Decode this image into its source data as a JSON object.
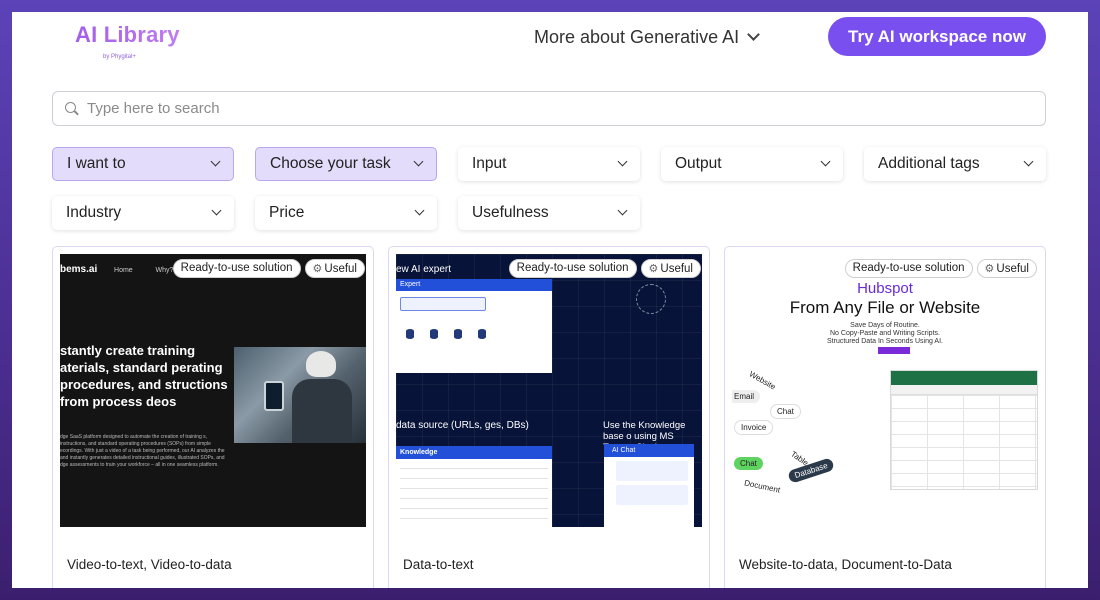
{
  "header": {
    "logo_title": "AI Library",
    "logo_sub": "by Phygital+",
    "nav_more": "More about Generative AI",
    "cta": "Try AI workspace now"
  },
  "search": {
    "placeholder": "Type here to search"
  },
  "filters": [
    {
      "label": "I want to",
      "active": true
    },
    {
      "label": "Choose your task",
      "active": true
    },
    {
      "label": "Input",
      "active": false
    },
    {
      "label": "Output",
      "active": false
    },
    {
      "label": "Additional tags",
      "active": false
    },
    {
      "label": "Industry",
      "active": false
    },
    {
      "label": "Price",
      "active": false
    },
    {
      "label": "Usefulness",
      "active": false
    }
  ],
  "badges": {
    "ready": "Ready-to-use solution",
    "useful": "Useful"
  },
  "cards": [
    {
      "tags": "Video-to-text, Video-to-data",
      "img_brand": "bems.ai",
      "img_home": "Home",
      "img_why": "Why?",
      "img_headline": "stantly create training aterials, standard perating procedures, and structions from process deos",
      "img_body": "dge SaaS platform designed to automate the creation of training s, instructions, and standard operating procedures (SOPs) from simple ecordings. With just a video of a task being performed, our AI analyzes the and instantly generates detailed instructional guides, illustrated SOPs, and dge assessments to train your workforce – all in one seamless platform."
    },
    {
      "tags": "Data-to-text",
      "img_title": "ew AI expert",
      "img_panel_title": "Expert",
      "img_mid": "data source (URLs, ges, DBs)",
      "img_knowledge": "Knowledge",
      "img_right": "Use the Knowledge base o using MS Teams, Slack, or",
      "img_chat": "AI Chat"
    },
    {
      "tags": "Website-to-data, Document-to-Data",
      "img_brand": "Hubspot",
      "img_headline": "From Any File or Website",
      "img_sub1": "Save Days of Routine.",
      "img_sub2": "No Copy-Paste and Writing Scripts.",
      "img_sub3": "Structured Data In Seconds Using AI.",
      "img_pills": [
        "Website",
        "Email",
        "Chat",
        "Invoice",
        "Chat",
        "Table",
        "Database",
        "Document"
      ]
    }
  ],
  "colors": {
    "accent": "#7a4ff0",
    "active_filter": "#e4dcfb",
    "chat_green": "#5fd35f"
  }
}
